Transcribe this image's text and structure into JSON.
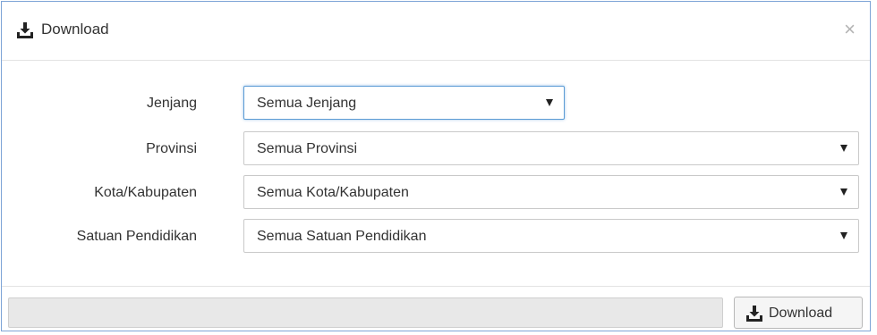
{
  "dialog": {
    "title": "Download",
    "close_glyph": "×",
    "icon": "download-icon"
  },
  "fields": [
    {
      "label": "Jenjang",
      "value": "Semua Jenjang"
    },
    {
      "label": "Provinsi",
      "value": "Semua Provinsi"
    },
    {
      "label": "Kota/Kabupaten",
      "value": "Semua Kota/Kabupaten"
    },
    {
      "label": "Satuan Pendidikan",
      "value": "Semua Satuan Pendidikan"
    }
  ],
  "footer": {
    "progress_fraction": 0,
    "download_button_label": "Download",
    "download_button_icon": "download-icon"
  },
  "colors": {
    "dialog_border": "#7da4d6",
    "focus_border": "#5b9bd5",
    "progress_bg": "#e8e8e8"
  }
}
